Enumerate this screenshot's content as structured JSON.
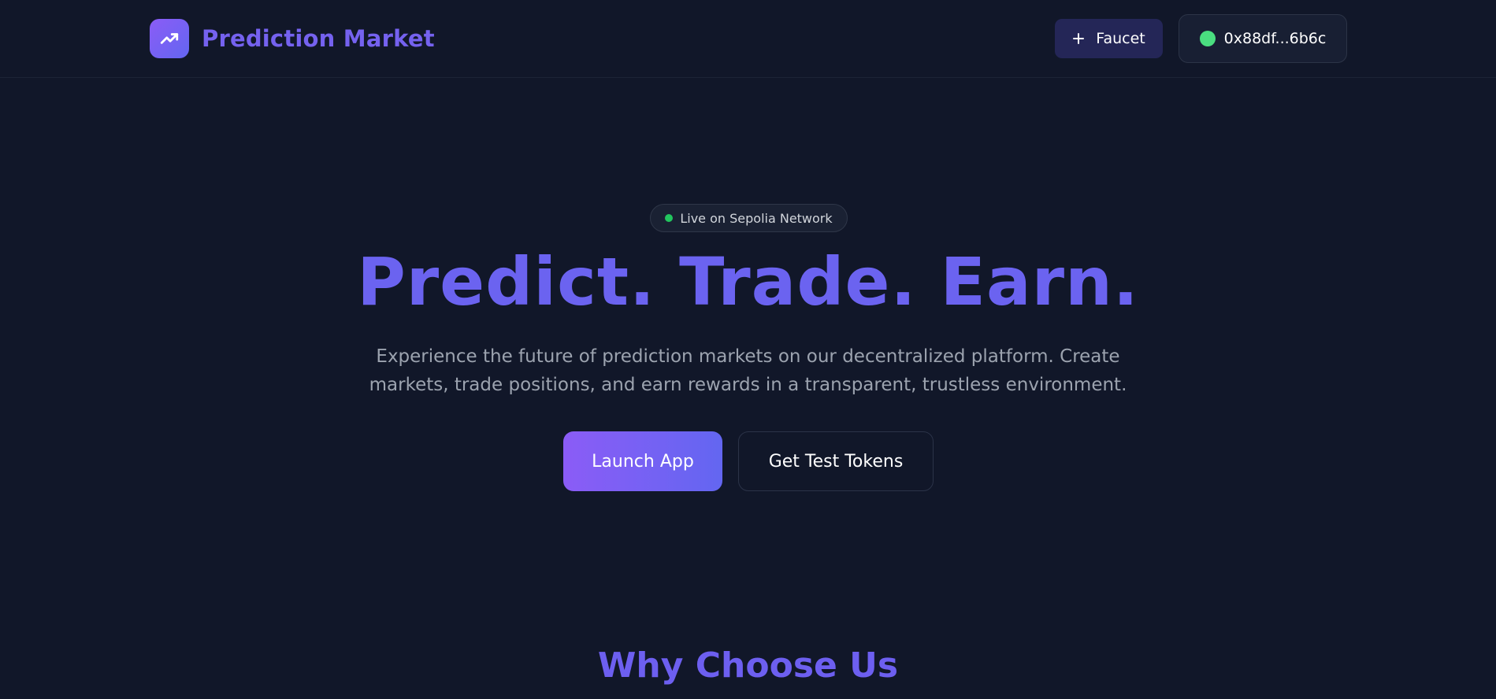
{
  "header": {
    "brand_title": "Prediction Market",
    "brand_icon": "trending-up-icon",
    "faucet_label": "Faucet",
    "faucet_icon": "plus-icon",
    "wallet_address": "0x88df...6b6c",
    "wallet_status_color": "#4ade80"
  },
  "hero": {
    "badge_text": "Live on Sepolia Network",
    "badge_dot_color": "#22c55e",
    "title": "Predict. Trade. Earn.",
    "subtitle_line1": "Experience the future of prediction markets on our decentralized platform. Create",
    "subtitle_line2": "markets, trade positions, and earn rewards in a transparent, trustless environment.",
    "primary_button": "Launch App",
    "secondary_button": "Get Test Tokens"
  },
  "features": {
    "section_title": "Why Choose Us"
  },
  "colors": {
    "background": "#111729",
    "accent": "#6b63f0",
    "accent_gradient_start": "#8b5cf6",
    "accent_gradient_end": "#6366f1"
  }
}
